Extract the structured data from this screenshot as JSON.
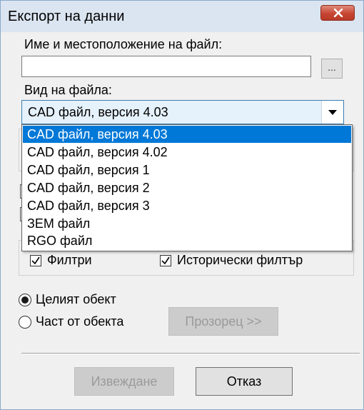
{
  "window": {
    "title": "Експорт на данни"
  },
  "file": {
    "name_label": "Име и местоположение на файл:",
    "name_value": "",
    "browse_label": "...",
    "type_label": "Вид на файла:",
    "type_selected": "CAD файл, версия 4.03"
  },
  "dropdown": {
    "options": [
      "CAD файл, версия 4.03",
      "CAD файл, версия 4.02",
      "CAD файл, версия 1",
      "CAD файл, версия 2",
      "CAD файл, версия 3",
      "ЗЕМ файл",
      "RGO файл"
    ],
    "highlighted_index": 0
  },
  "filters": {
    "filters_label": "Филтри",
    "filters_checked": true,
    "historical_label": "Исторически филтър",
    "historical_checked": true
  },
  "scope": {
    "whole_label": "Целият обект",
    "whole_selected": true,
    "part_label": "Част от обекта",
    "part_selected": false,
    "window_button": "Прозорец >>"
  },
  "actions": {
    "export_label": "Извеждане",
    "cancel_label": "Отказ"
  },
  "colors": {
    "selection": "#0078d7",
    "close_button": "#c74633"
  }
}
